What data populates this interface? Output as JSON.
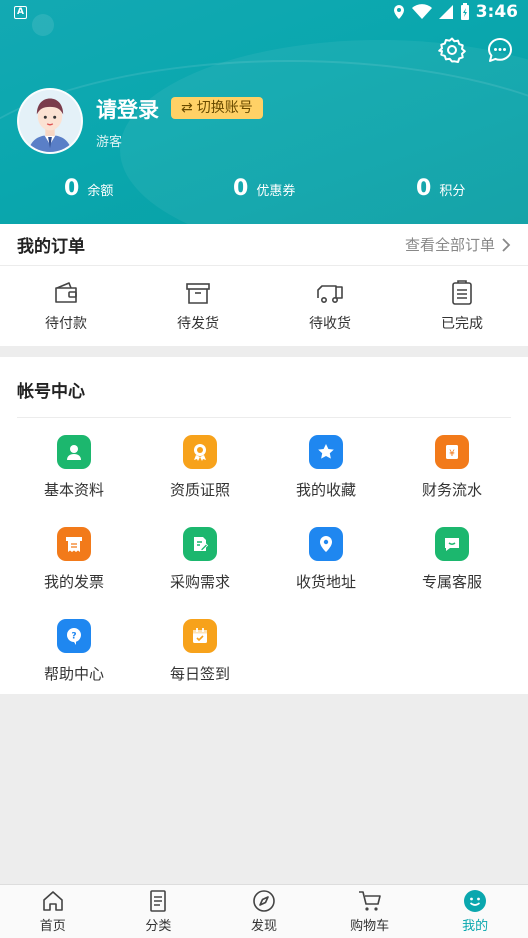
{
  "status_bar": {
    "time": "3:46"
  },
  "header": {
    "login_title": "请登录",
    "switch_account": "切换账号",
    "guest_label": "游客",
    "stats": [
      {
        "value": "0",
        "label": "余额"
      },
      {
        "value": "0",
        "label": "优惠券"
      },
      {
        "value": "0",
        "label": "积分"
      }
    ]
  },
  "orders": {
    "title": "我的订单",
    "view_all": "查看全部订单",
    "items": [
      {
        "label": "待付款",
        "icon": "wallet-icon"
      },
      {
        "label": "待发货",
        "icon": "box-icon"
      },
      {
        "label": "待收货",
        "icon": "truck-icon"
      },
      {
        "label": "已完成",
        "icon": "clipboard-icon"
      }
    ]
  },
  "account": {
    "title": "帐号中心",
    "items": [
      {
        "label": "基本资料",
        "icon": "user-icon",
        "color": "#1cb76e"
      },
      {
        "label": "资质证照",
        "icon": "certificate-icon",
        "color": "#f7a21b"
      },
      {
        "label": "我的收藏",
        "icon": "star-icon",
        "color": "#1f87f0"
      },
      {
        "label": "财务流水",
        "icon": "finance-icon",
        "color": "#f27a1a"
      },
      {
        "label": "我的发票",
        "icon": "invoice-icon",
        "color": "#f27a1a"
      },
      {
        "label": "采购需求",
        "icon": "edit-icon",
        "color": "#1cb76e"
      },
      {
        "label": "收货地址",
        "icon": "location-icon",
        "color": "#1f87f0"
      },
      {
        "label": "专属客服",
        "icon": "chat-icon",
        "color": "#1cb76e"
      },
      {
        "label": "帮助中心",
        "icon": "help-icon",
        "color": "#1f87f0"
      },
      {
        "label": "每日签到",
        "icon": "calendar-icon",
        "color": "#f7a21b"
      }
    ]
  },
  "tabbar": {
    "items": [
      {
        "label": "首页",
        "icon": "home-icon"
      },
      {
        "label": "分类",
        "icon": "list-icon"
      },
      {
        "label": "发现",
        "icon": "compass-icon"
      },
      {
        "label": "购物车",
        "icon": "cart-icon"
      },
      {
        "label": "我的",
        "icon": "smile-icon",
        "active": true
      }
    ]
  },
  "colors": {
    "brand": "#0aa7ae",
    "badge": "#ffd166"
  }
}
